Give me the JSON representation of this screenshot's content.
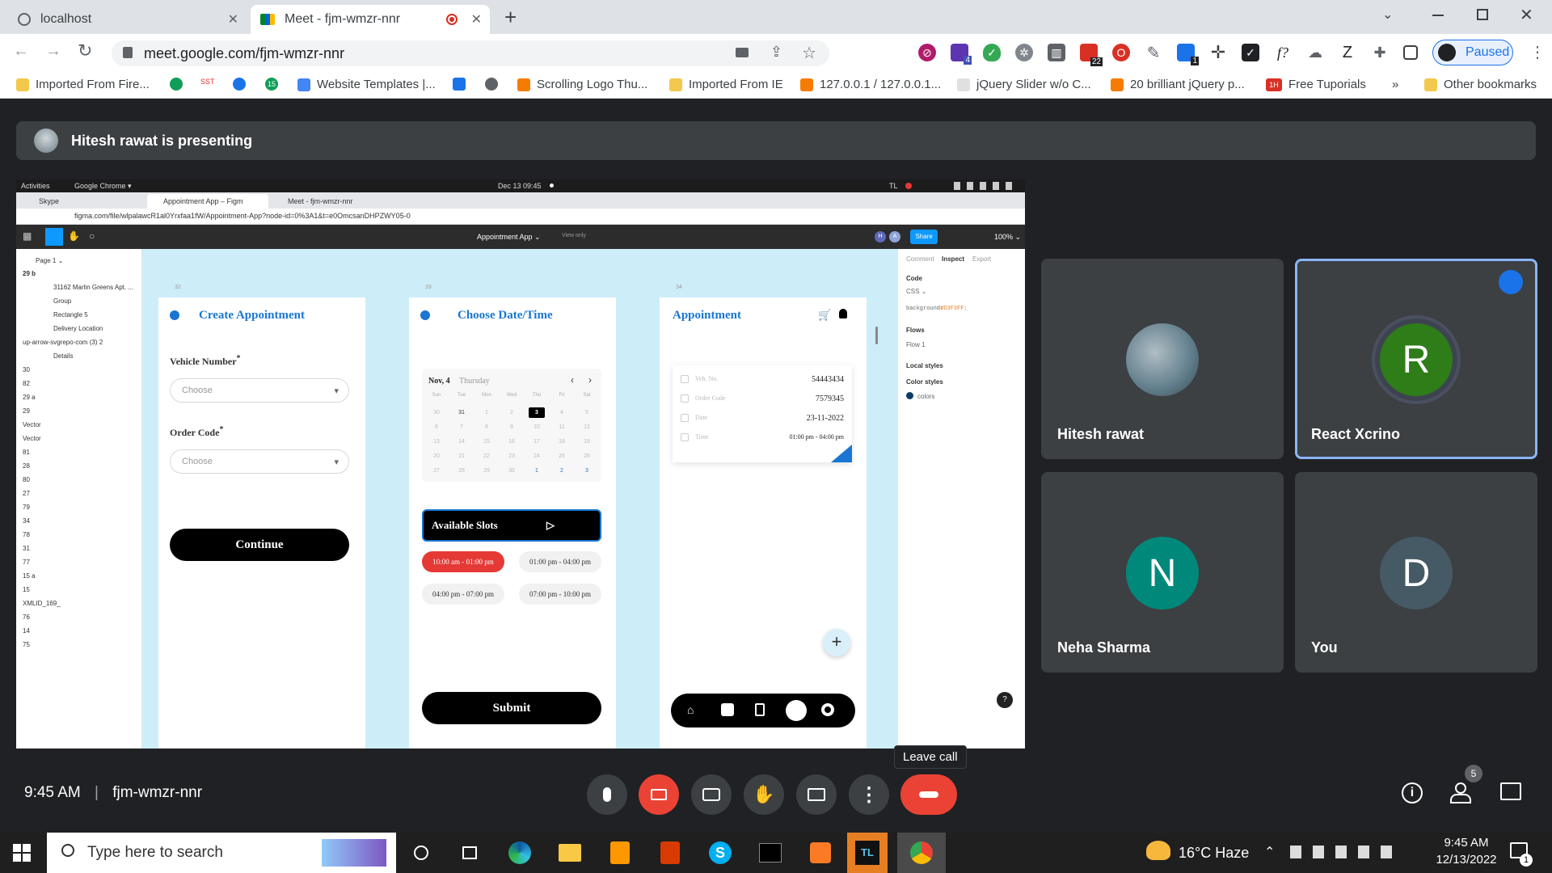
{
  "browser": {
    "tabs": [
      {
        "title": "localhost",
        "close": "✕"
      },
      {
        "title": "Meet - fjm-wmzr-nnr",
        "close": "✕"
      }
    ],
    "new_tab": "+",
    "url": "meet.google.com/fjm-wmzr-nnr",
    "profile_status": "Paused",
    "ext_badges": {
      "purple": "4",
      "red": "22",
      "blue": "1"
    },
    "bookmarks": [
      "Imported From Fire...",
      "SST",
      "Website Templates |...",
      "Scrolling Logo Thu...",
      "Imported From IE",
      "127.0.0.1 / 127.0.0.1...",
      "jQuery Slider w/o C...",
      "20 brilliant jQuery p...",
      "Free Tuporials",
      "»",
      "Other bookmarks"
    ],
    "badge_15": "15",
    "tl_fav": "1H"
  },
  "meet": {
    "presenting_text": "Hitesh rawat is presenting",
    "time": "9:45 AM",
    "separator": "|",
    "meeting_code": "fjm-wmzr-nnr",
    "leave_tooltip": "Leave call",
    "people_count": "5",
    "participants": [
      {
        "name": "Hitesh rawat",
        "initial": ""
      },
      {
        "name": "React Xcrino",
        "initial": "R"
      },
      {
        "name": "Neha Sharma",
        "initial": "N"
      },
      {
        "name": "You",
        "initial": "D"
      }
    ]
  },
  "shared": {
    "ubuntu": {
      "activities": "Activities",
      "app": "Google Chrome ▾",
      "clock": "Dec 13  09:45",
      "tl": "TL"
    },
    "tabs": [
      "Skype",
      "Appointment App – Figm",
      "Meet - fjm-wmzr-nnr"
    ],
    "url": "figma.com/file/wlpalawcR1al0Yrxfaa1fW/Appointment-App?node-id=0%3A1&t=e0OmcsanDHPZWY05-0",
    "figma": {
      "file": "Appointment App ⌄",
      "view_only": "View only",
      "share": "Share",
      "zoom": "100% ⌄",
      "avatars": [
        "H",
        "A"
      ],
      "page": "Page 1 ⌄",
      "layers": [
        "29 b",
        "31162 Marlin Greens Apt. ...",
        "Group",
        "Rectangle 5",
        "Delivery Location",
        "up-arrow-svgrepo-com (3) 2",
        "Details",
        "30",
        "82",
        "29 a",
        "29",
        "Vector",
        "Vector",
        "81",
        "28",
        "80",
        "27",
        "79",
        "34",
        "78",
        "31",
        "77",
        "15 a",
        "15",
        "XMLID_169_",
        "76",
        "14",
        "75"
      ],
      "frame_numbers": [
        "32",
        "33",
        "34"
      ],
      "panel_tabs": [
        "Comment",
        "Inspect",
        "Export"
      ],
      "code_label": "Code",
      "css_label": "CSS ⌄",
      "bg_prop": "background:",
      "bg_value": "#D3F3FF;",
      "flows": "Flows",
      "flow1": "Flow 1",
      "local_styles": "Local styles",
      "color_styles": "Color styles",
      "color_name": "colors",
      "help": "?"
    },
    "screen1": {
      "title": "Create Appointment",
      "vehicle_label": "Vehicle Number",
      "order_label": "Order Code",
      "asterisk": "*",
      "placeholder": "Choose",
      "continue": "Continue"
    },
    "screen2": {
      "title": "Choose Date/Time",
      "date": "Nov, 4",
      "day": "Thursday",
      "weekdays": [
        "Sun",
        "Tue",
        "Mon",
        "Wed",
        "Thu",
        "Fri",
        "Sat"
      ],
      "calendar_rows": [
        [
          "30",
          "31",
          "1",
          "2",
          "3",
          "4",
          "5"
        ],
        [
          "6",
          "7",
          "8",
          "9",
          "10",
          "11",
          "12"
        ],
        [
          "13",
          "14",
          "15",
          "16",
          "17",
          "18",
          "19"
        ],
        [
          "20",
          "21",
          "22",
          "23",
          "24",
          "25",
          "26"
        ],
        [
          "27",
          "28",
          "29",
          "30",
          "1",
          "2",
          "3"
        ]
      ],
      "available": "Available Slots",
      "slots": [
        "10:00 am - 01:00 pm",
        "01:00 pm - 04:00 pm",
        "04:00 pm - 07:00 pm",
        "07:00 pm - 10:00 pm"
      ],
      "submit": "Submit"
    },
    "screen3": {
      "title": "Appointment",
      "fields": [
        {
          "label": "Veh. No.",
          "value": "54443434"
        },
        {
          "label": "Order Code",
          "value": "7579345"
        },
        {
          "label": "Date",
          "value": "23-11-2022"
        },
        {
          "label": "Time",
          "value": "01:00 pm - 04:00 pm"
        }
      ],
      "fab": "+"
    }
  },
  "taskbar": {
    "search_placeholder": "Type here to search",
    "weather": "16°C  Haze",
    "time": "9:45 AM",
    "date": "12/13/2022",
    "notif": "1"
  },
  "colors": {
    "accent": "#1a73e8",
    "meet_red": "#ea4335",
    "fig_blue": "#0d99ff",
    "canvas": "#cdeef9",
    "green_avatar": "#2e7d18",
    "teal_avatar": "#00897b"
  }
}
